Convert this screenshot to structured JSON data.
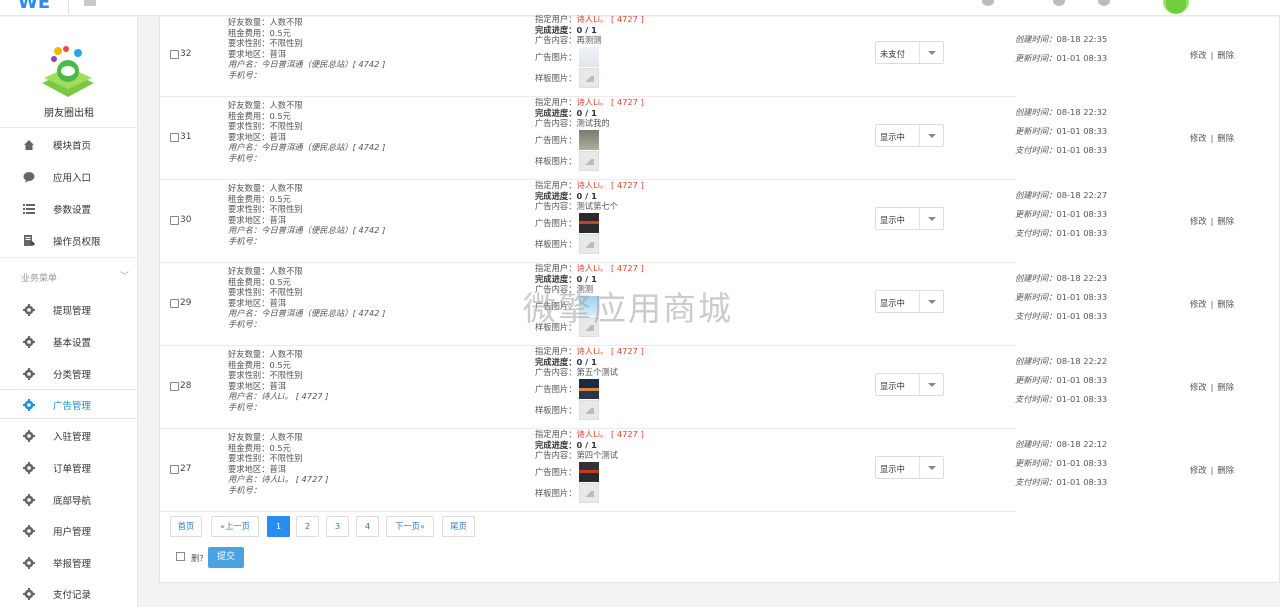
{
  "header": {
    "logo": "WE"
  },
  "sidebar": {
    "brand_name": "朋友圈出租",
    "top_items": [
      {
        "label": "模块首页",
        "icon": "home-icon"
      },
      {
        "label": "应用入口",
        "icon": "chat-icon"
      },
      {
        "label": "参数设置",
        "icon": "list-icon"
      },
      {
        "label": "操作员权限",
        "icon": "edit-icon"
      }
    ],
    "section_title": "业务菜单",
    "items": [
      {
        "label": "提现管理",
        "icon": "gear-icon"
      },
      {
        "label": "基本设置",
        "icon": "gear-icon"
      },
      {
        "label": "分类管理",
        "icon": "gear-icon"
      },
      {
        "label": "广告管理",
        "icon": "gear-icon",
        "active": true
      },
      {
        "label": "入驻管理",
        "icon": "gear-icon"
      },
      {
        "label": "订单管理",
        "icon": "gear-icon"
      },
      {
        "label": "底部导航",
        "icon": "gear-icon"
      },
      {
        "label": "用户管理",
        "icon": "gear-icon"
      },
      {
        "label": "举报管理",
        "icon": "gear-icon"
      },
      {
        "label": "支付记录",
        "icon": "gear-icon"
      }
    ]
  },
  "colors": {
    "accent": "#2a8cf0",
    "red": "#e4442c",
    "submit": "#4aa3df"
  },
  "rows": [
    {
      "id": "32",
      "friends": "好友数量：人数不限",
      "price": "租金费用：0.5元",
      "gender": "要求性别：不限性别",
      "region": "要求地区：普洱",
      "user": "用户名：今日普洱通（便民总站）[ 4742 ]",
      "phone": "手机号：",
      "assign_label": "指定用户：",
      "assign_value": "诗人Li。 [ 4727 ]",
      "progress": "完成进度：0 / 1",
      "content": "广告内容：再测测",
      "ad_img_label": "广告图片：",
      "sample_label": "样板图片：",
      "status": "未支付",
      "created": "08-18 22:35",
      "updated": "01-01 08:33",
      "paid": "",
      "edit": "修改",
      "sep": "|",
      "delete": "删除"
    },
    {
      "id": "31",
      "friends": "好友数量：人数不限",
      "price": "租金费用：0.5元",
      "gender": "要求性别：不限性别",
      "region": "要求地区：普洱",
      "user": "用户名：今日普洱通（便民总站）[ 4742 ]",
      "phone": "手机号：",
      "assign_label": "指定用户：",
      "assign_value": "诗人Li。 [ 4727 ]",
      "progress": "完成进度：0 / 1",
      "content": "广告内容：测试我的",
      "ad_img_label": "广告图片：",
      "sample_label": "样板图片：",
      "status": "显示中",
      "created": "08-18 22:32",
      "updated": "01-01 08:33",
      "paid": "01-01 08:33",
      "edit": "修改",
      "sep": "|",
      "delete": "删除"
    },
    {
      "id": "30",
      "friends": "好友数量：人数不限",
      "price": "租金费用：0.5元",
      "gender": "要求性别：不限性别",
      "region": "要求地区：普洱",
      "user": "用户名：今日普洱通（便民总站）[ 4742 ]",
      "phone": "手机号：",
      "assign_label": "指定用户：",
      "assign_value": "诗人Li。 [ 4727 ]",
      "progress": "完成进度：0 / 1",
      "content": "广告内容：测试第七个",
      "ad_img_label": "广告图片：",
      "sample_label": "样板图片：",
      "status": "显示中",
      "created": "08-18 22:27",
      "updated": "01-01 08:33",
      "paid": "01-01 08:33",
      "edit": "修改",
      "sep": "|",
      "delete": "删除"
    },
    {
      "id": "29",
      "friends": "好友数量：人数不限",
      "price": "租金费用：0.5元",
      "gender": "要求性别：不限性别",
      "region": "要求地区：普洱",
      "user": "用户名：今日普洱通（便民总站）[ 4742 ]",
      "phone": "手机号：",
      "assign_label": "指定用户：",
      "assign_value": "诗人Li。 [ 4727 ]",
      "progress": "完成进度：0 / 1",
      "content": "广告内容：测测",
      "ad_img_label": "广告图片：",
      "sample_label": "样板图片：",
      "status": "显示中",
      "created": "08-18 22:23",
      "updated": "01-01 08:33",
      "paid": "01-01 08:33",
      "edit": "修改",
      "sep": "|",
      "delete": "删除"
    },
    {
      "id": "28",
      "friends": "好友数量：人数不限",
      "price": "租金费用：0.5元",
      "gender": "要求性别：不限性别",
      "region": "要求地区：普洱",
      "user": "用户名：诗人Li。 [ 4727 ]",
      "phone": "手机号：",
      "assign_label": "指定用户：",
      "assign_value": "诗人Li。 [ 4727 ]",
      "progress": "完成进度：0 / 1",
      "content": "广告内容：第五个测试",
      "ad_img_label": "广告图片：",
      "sample_label": "样板图片：",
      "status": "显示中",
      "created": "08-18 22:22",
      "updated": "01-01 08:33",
      "paid": "01-01 08:33",
      "edit": "修改",
      "sep": "|",
      "delete": "删除"
    },
    {
      "id": "27",
      "friends": "好友数量：人数不限",
      "price": "租金费用：0.5元",
      "gender": "要求性别：不限性别",
      "region": "要求地区：普洱",
      "user": "用户名：诗人Li。 [ 4727 ]",
      "phone": "手机号：",
      "assign_label": "指定用户：",
      "assign_value": "诗人Li。 [ 4727 ]",
      "progress": "完成进度：0 / 1",
      "content": "广告内容：第四个测试",
      "ad_img_label": "广告图片：",
      "sample_label": "样板图片：",
      "status": "显示中",
      "created": "08-18 22:12",
      "updated": "01-01 08:33",
      "paid": "01-01 08:33",
      "edit": "修改",
      "sep": "|",
      "delete": "删除"
    }
  ],
  "time_labels": {
    "created": "创建时间：",
    "updated": "更新时间：",
    "paid": "支付时间："
  },
  "pagination": [
    "首页",
    "«上一页",
    "1",
    "2",
    "3",
    "4",
    "下一页»",
    "尾页"
  ],
  "footer": {
    "delete_label": "删?",
    "submit": "提交"
  },
  "watermark": "微擎应用商城"
}
